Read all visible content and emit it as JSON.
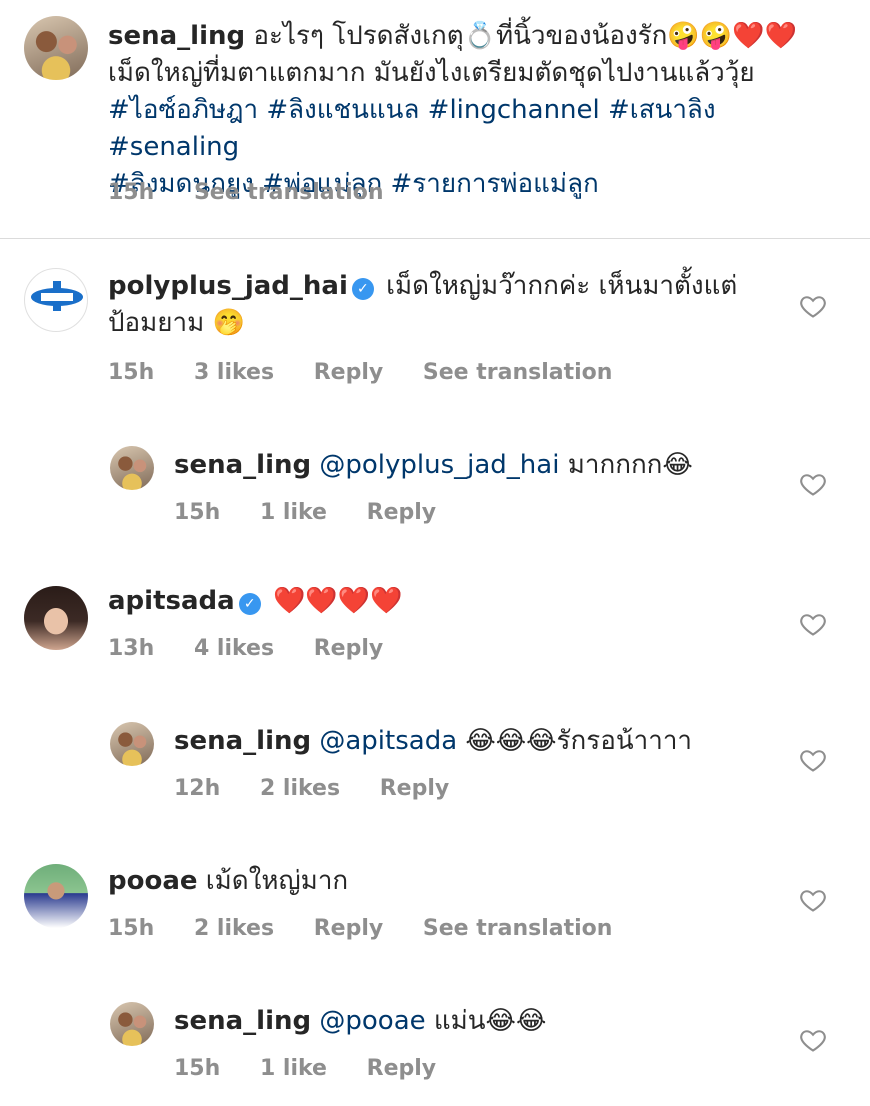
{
  "caption": {
    "username": "sena_ling",
    "text_line1": "อะไรๆ โปรดสังเกตุ💍ที่นิ้วของน้องรัก🤪🤪❤️❤️",
    "text_line2": "เม็ดใหญ่ที่มตาแตกมาก มันยังไงเตรียมตัดชุดไปงานแล้ววุ้ย",
    "hashtags_line1": "#ไอซ์อภิษฎา #ลิงแชนแนล #lingchannel #เสนาลิง #senaling",
    "hashtags_line2": "#ลิงมดนกยูง #พ่อแม่ลูก #รายการพ่อแม่ลูก",
    "time": "15h",
    "translate": "See translation"
  },
  "comments": [
    {
      "username": "polyplus_jad_hai",
      "verified": true,
      "avatar_logo": "Polyplus",
      "text_line1": "เม็ดใหญ่มว๊ากกค่ะ เห็นมาตั้งแต่",
      "text_line2": "ป้อมยาม 🤭",
      "time": "15h",
      "likes": "3 likes",
      "reply": "Reply",
      "translate": "See translation"
    },
    {
      "username": "sena_ling",
      "mention": "@polyplus_jad_hai",
      "text": " มากกกก😂",
      "time": "15h",
      "likes": "1 like",
      "reply": "Reply"
    },
    {
      "username": "apitsada",
      "verified": true,
      "text": "❤️❤️❤️❤️",
      "time": "13h",
      "likes": "4 likes",
      "reply": "Reply"
    },
    {
      "username": "sena_ling",
      "mention": "@apitsada",
      "text": " 😂😂😂รักรอน้าาาา",
      "time": "12h",
      "likes": "2 likes",
      "reply": "Reply"
    },
    {
      "username": "pooae",
      "text": "เม้ดใหญ่มาก",
      "time": "15h",
      "likes": "2 likes",
      "reply": "Reply",
      "translate": "See translation"
    },
    {
      "username": "sena_ling",
      "mention": "@pooae",
      "text": " แม่น😂😂",
      "time": "15h",
      "likes": "1 like",
      "reply": "Reply"
    }
  ],
  "icons": {
    "like": "heart-outline-icon",
    "verified": "verified-badge-icon"
  },
  "colors": {
    "link": "#00376b",
    "muted": "#8e8e8e",
    "verified": "#3897f0"
  }
}
